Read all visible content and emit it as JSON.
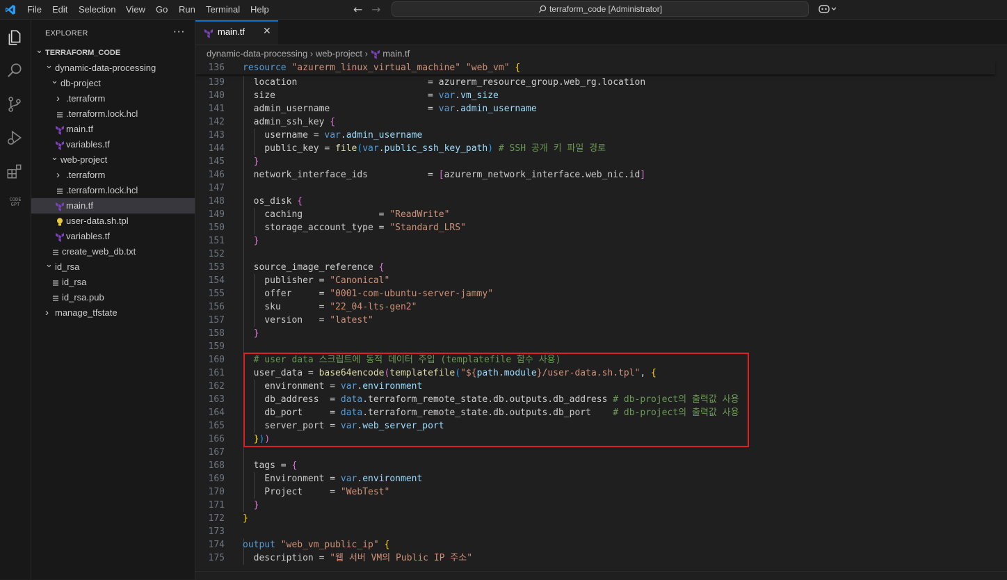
{
  "menu": [
    "File",
    "Edit",
    "Selection",
    "View",
    "Go",
    "Run",
    "Terminal",
    "Help"
  ],
  "search": {
    "text": "terraform_code [Administrator]"
  },
  "activity": [
    "explorer-icon",
    "search-icon",
    "source-control-icon",
    "run-debug-icon",
    "extensions-icon",
    "codegpt-icon"
  ],
  "activity_codegpt_label": "CODE GPT",
  "explorer": {
    "title": "EXPLORER",
    "more": "···",
    "tree": [
      {
        "label": "TERRAFORM_CODE",
        "depth": 0,
        "kind": "root",
        "open": true
      },
      {
        "label": "dynamic-data-processing",
        "depth": 1,
        "kind": "folder",
        "open": true
      },
      {
        "label": "db-project",
        "depth": 2,
        "kind": "folder",
        "open": true
      },
      {
        "label": ".terraform",
        "depth": 3,
        "kind": "folder",
        "open": false
      },
      {
        "label": ".terraform.lock.hcl",
        "depth": 3,
        "kind": "text"
      },
      {
        "label": "main.tf",
        "depth": 3,
        "kind": "tf"
      },
      {
        "label": "variables.tf",
        "depth": 3,
        "kind": "tf"
      },
      {
        "label": "web-project",
        "depth": 2,
        "kind": "folder",
        "open": true
      },
      {
        "label": ".terraform",
        "depth": 3,
        "kind": "folder",
        "open": false
      },
      {
        "label": ".terraform.lock.hcl",
        "depth": 3,
        "kind": "text"
      },
      {
        "label": "main.tf",
        "depth": 3,
        "kind": "tf",
        "selected": true
      },
      {
        "label": "user-data.sh.tpl",
        "depth": 3,
        "kind": "tpl"
      },
      {
        "label": "variables.tf",
        "depth": 3,
        "kind": "tf"
      },
      {
        "label": "create_web_db.txt",
        "depth": 2,
        "kind": "text"
      },
      {
        "label": "id_rsa",
        "depth": 1,
        "kind": "folder",
        "open": true
      },
      {
        "label": "id_rsa",
        "depth": 2,
        "kind": "text"
      },
      {
        "label": "id_rsa.pub",
        "depth": 2,
        "kind": "text"
      },
      {
        "label": "manage_tfstate",
        "depth": 1,
        "kind": "folder",
        "open": false
      }
    ]
  },
  "tab": {
    "label": "main.tf",
    "close": "✕"
  },
  "breadcrumb": [
    "dynamic-data-processing",
    "web-project",
    "main.tf"
  ],
  "editor": {
    "sticky": {
      "n": "136",
      "t": [
        [
          "resource ",
          "kw"
        ],
        [
          "\"azurerm_linux_virtual_machine\"",
          "str"
        ],
        [
          " ",
          "p"
        ],
        [
          "\"web_vm\"",
          "str"
        ],
        [
          " ",
          "p"
        ],
        [
          "{",
          "b1"
        ]
      ]
    },
    "lines": [
      {
        "n": "139",
        "t": [
          [
            "  location                        = azurerm_resource_group.web_rg.location",
            "attr"
          ]
        ]
      },
      {
        "n": "140",
        "t": [
          [
            "  size                            = ",
            "attr"
          ],
          [
            "var",
            "var"
          ],
          [
            ".",
            "p"
          ],
          [
            "vm_size",
            "prop"
          ]
        ]
      },
      {
        "n": "141",
        "t": [
          [
            "  admin_username                  = ",
            "attr"
          ],
          [
            "var",
            "var"
          ],
          [
            ".",
            "p"
          ],
          [
            "admin_username",
            "prop"
          ]
        ]
      },
      {
        "n": "142",
        "t": [
          [
            "  admin_ssh_key ",
            "attr"
          ],
          [
            "{",
            "b2"
          ]
        ]
      },
      {
        "n": "143",
        "t": [
          [
            "    username = ",
            "attr"
          ],
          [
            "var",
            "var"
          ],
          [
            ".",
            "p"
          ],
          [
            "admin_username",
            "prop"
          ]
        ]
      },
      {
        "n": "144",
        "t": [
          [
            "    public_key = ",
            "attr"
          ],
          [
            "file",
            "fn"
          ],
          [
            "(",
            "b3"
          ],
          [
            "var",
            "var"
          ],
          [
            ".",
            "p"
          ],
          [
            "public_ssh_key_path",
            "prop"
          ],
          [
            ")",
            "b3"
          ],
          [
            " # SSH 공개 키 파일 경로",
            "cm"
          ]
        ]
      },
      {
        "n": "145",
        "t": [
          [
            "  ",
            "p"
          ],
          [
            "}",
            "b2"
          ]
        ]
      },
      {
        "n": "146",
        "t": [
          [
            "  network_interface_ids           = ",
            "attr"
          ],
          [
            "[",
            "b2"
          ],
          [
            "azurerm_network_interface.web_nic.id",
            "attr"
          ],
          [
            "]",
            "b2"
          ]
        ]
      },
      {
        "n": "147",
        "t": []
      },
      {
        "n": "148",
        "t": [
          [
            "  os_disk ",
            "attr"
          ],
          [
            "{",
            "b2"
          ]
        ]
      },
      {
        "n": "149",
        "t": [
          [
            "    caching              = ",
            "attr"
          ],
          [
            "\"ReadWrite\"",
            "str"
          ]
        ]
      },
      {
        "n": "150",
        "t": [
          [
            "    storage_account_type = ",
            "attr"
          ],
          [
            "\"Standard_LRS\"",
            "str"
          ]
        ]
      },
      {
        "n": "151",
        "t": [
          [
            "  ",
            "p"
          ],
          [
            "}",
            "b2"
          ]
        ]
      },
      {
        "n": "152",
        "t": []
      },
      {
        "n": "153",
        "t": [
          [
            "  source_image_reference ",
            "attr"
          ],
          [
            "{",
            "b2"
          ]
        ]
      },
      {
        "n": "154",
        "t": [
          [
            "    publisher = ",
            "attr"
          ],
          [
            "\"Canonical\"",
            "str"
          ]
        ]
      },
      {
        "n": "155",
        "t": [
          [
            "    offer     = ",
            "attr"
          ],
          [
            "\"0001-com-ubuntu-server-jammy\"",
            "str"
          ]
        ]
      },
      {
        "n": "156",
        "t": [
          [
            "    sku       = ",
            "attr"
          ],
          [
            "\"22_04-lts-gen2\"",
            "str"
          ]
        ]
      },
      {
        "n": "157",
        "t": [
          [
            "    version   = ",
            "attr"
          ],
          [
            "\"latest\"",
            "str"
          ]
        ]
      },
      {
        "n": "158",
        "t": [
          [
            "  ",
            "p"
          ],
          [
            "}",
            "b2"
          ]
        ]
      },
      {
        "n": "159",
        "t": []
      },
      {
        "n": "160",
        "t": [
          [
            "  # user data 스크립트에 동적 데이터 주입 (templatefile 함수 사용)",
            "cm"
          ]
        ]
      },
      {
        "n": "161",
        "t": [
          [
            "  user_data = ",
            "attr"
          ],
          [
            "base64encode",
            "fn"
          ],
          [
            "(",
            "b2"
          ],
          [
            "templatefile",
            "fn"
          ],
          [
            "(",
            "b3"
          ],
          [
            "\"${",
            "str"
          ],
          [
            "path",
            "prop"
          ],
          [
            ".",
            "p"
          ],
          [
            "module",
            "prop"
          ],
          [
            "}/user-data.sh.tpl\"",
            "str"
          ],
          [
            ", ",
            "p"
          ],
          [
            "{",
            "b1"
          ]
        ]
      },
      {
        "n": "162",
        "t": [
          [
            "    environment = ",
            "attr"
          ],
          [
            "var",
            "var"
          ],
          [
            ".",
            "p"
          ],
          [
            "environment",
            "prop"
          ]
        ]
      },
      {
        "n": "163",
        "t": [
          [
            "    db_address  = ",
            "attr"
          ],
          [
            "data",
            "var"
          ],
          [
            ".terraform_remote_state.db.outputs.db_address",
            "attr"
          ],
          [
            " # db-project의 출력값 사용",
            "cm"
          ]
        ]
      },
      {
        "n": "164",
        "t": [
          [
            "    db_port     = ",
            "attr"
          ],
          [
            "data",
            "var"
          ],
          [
            ".terraform_remote_state.db.outputs.db_port    ",
            "attr"
          ],
          [
            "# db-project의 출력값 사용",
            "cm"
          ]
        ]
      },
      {
        "n": "165",
        "t": [
          [
            "    server_port = ",
            "attr"
          ],
          [
            "var",
            "var"
          ],
          [
            ".",
            "p"
          ],
          [
            "web_server_port",
            "prop"
          ]
        ]
      },
      {
        "n": "166",
        "t": [
          [
            "  ",
            "p"
          ],
          [
            "}",
            "b1"
          ],
          [
            ")",
            "b3"
          ],
          [
            ")",
            "b2"
          ]
        ]
      },
      {
        "n": "167",
        "t": []
      },
      {
        "n": "168",
        "t": [
          [
            "  tags = ",
            "attr"
          ],
          [
            "{",
            "b2"
          ]
        ]
      },
      {
        "n": "169",
        "t": [
          [
            "    Environment = ",
            "attr"
          ],
          [
            "var",
            "var"
          ],
          [
            ".",
            "p"
          ],
          [
            "environment",
            "prop"
          ]
        ]
      },
      {
        "n": "170",
        "t": [
          [
            "    Project     = ",
            "attr"
          ],
          [
            "\"WebTest\"",
            "str"
          ]
        ]
      },
      {
        "n": "171",
        "t": [
          [
            "  ",
            "p"
          ],
          [
            "}",
            "b2"
          ]
        ]
      },
      {
        "n": "172",
        "t": [
          [
            "}",
            "b1"
          ]
        ]
      },
      {
        "n": "173",
        "t": []
      },
      {
        "n": "174",
        "t": [
          [
            "output ",
            "kw"
          ],
          [
            "\"web_vm_public_ip\"",
            "str"
          ],
          [
            " ",
            "p"
          ],
          [
            "{",
            "b1"
          ]
        ]
      },
      {
        "n": "175",
        "t": [
          [
            "  description = ",
            "attr"
          ],
          [
            "\"웹 서버 VM의 Public IP 주소\"",
            "str"
          ]
        ]
      }
    ]
  },
  "colors": {
    "accent": "#0078d4",
    "highlight_box": "#e02020",
    "tf_icon": "#7b42bc"
  }
}
